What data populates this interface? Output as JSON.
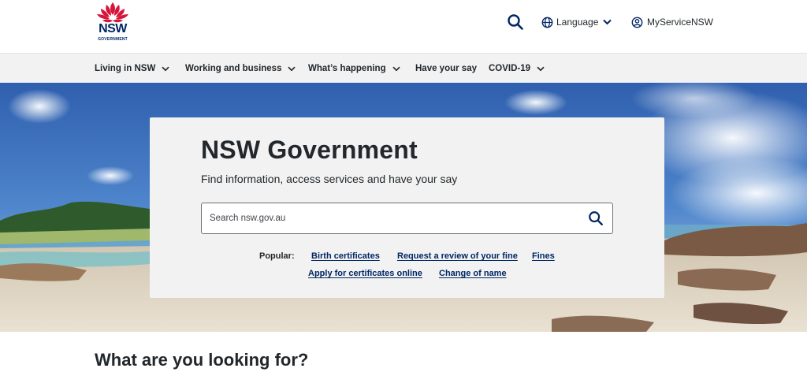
{
  "header": {
    "logo": {
      "wordmark": "NSW",
      "subtext": "GOVERNMENT",
      "icon": "waratah-icon",
      "colors": {
        "flower": "#d7153a",
        "text": "#002664"
      }
    },
    "utility": {
      "search_icon": "search-icon",
      "language_label": "Language",
      "language_icon": "globe-icon",
      "myservice_label": "MyServiceNSW",
      "myservice_icon": "user-circle-icon"
    }
  },
  "nav": {
    "items": [
      {
        "label": "Living in NSW",
        "has_dropdown": true
      },
      {
        "label": "Working and business",
        "has_dropdown": true
      },
      {
        "label": "What’s happening",
        "has_dropdown": true
      },
      {
        "label": "Have your say",
        "has_dropdown": false
      },
      {
        "label": "COVID-19",
        "has_dropdown": true
      }
    ]
  },
  "hero": {
    "title": "NSW Government",
    "subtitle": "Find information, access services and have your say",
    "search": {
      "placeholder": "Search nsw.gov.au",
      "value": ""
    },
    "popular": {
      "label": "Popular:",
      "links": [
        "Birth certificates",
        "Request a review of your fine",
        "Fines",
        "Apply for certificates online",
        "Change of name"
      ]
    }
  },
  "section": {
    "title": "What are you looking for?"
  },
  "colors": {
    "brand_navy": "#002664",
    "brand_red": "#d7153a",
    "nav_bg": "#f2f2f2"
  }
}
